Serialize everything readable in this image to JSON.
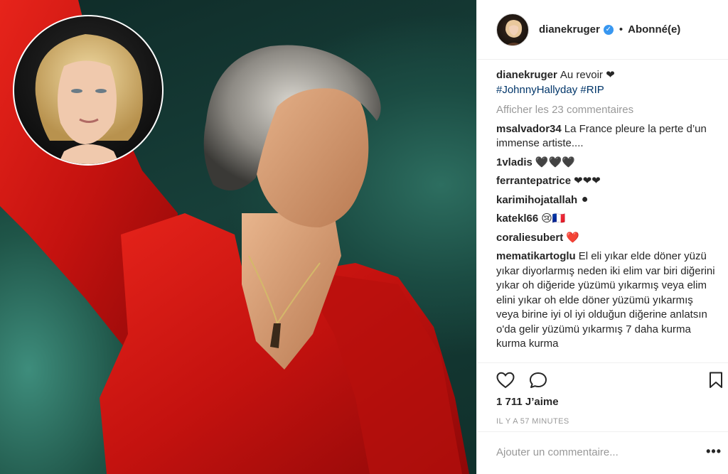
{
  "post": {
    "username": "dianekruger",
    "follow_status": "Abonné(e)",
    "separator": "•",
    "caption": {
      "username": "dianekruger",
      "text": "Au revoir ❤",
      "hashtags": "#JohnnyHallyday #RIP"
    },
    "view_comments_label": "Afficher les 23 commentaires",
    "comments": [
      {
        "username": "msalvador34",
        "text": "La France pleure la perte d’un immense artiste...."
      },
      {
        "username": "1vladis",
        "text": "🖤🖤🖤"
      },
      {
        "username": "ferrantepatrice",
        "text": "❤❤❤"
      },
      {
        "username": "karimihojatallah",
        "text": "⚫"
      },
      {
        "username": "katekl66",
        "text": "😢🇫🇷"
      },
      {
        "username": "coraliesubert",
        "text": "❤️"
      },
      {
        "username": "mematikartoglu",
        "text": "El eli yıkar elde döner yüzü yıkar diyorlarmış neden iki elim var biri diğerini yıkar oh diğeride yüzümü yıkarmış veya elim elini yıkar oh elde döner yüzümü yıkarmış veya birine iyi ol iyi olduğun diğerine anlatsın o'da gelir yüzümü yıkarmış 7 daha kurma kurma kurma"
      }
    ],
    "likes_label": "1 711 J’aime",
    "timestamp": "IL Y A 57 MINUTES",
    "add_comment_placeholder": "Ajouter un commentaire...",
    "options_label": "•••"
  },
  "icons": {
    "like": "heart-icon",
    "comment": "comment-icon",
    "save": "bookmark-icon",
    "verified": "verified-badge-icon",
    "options": "more-options-icon"
  },
  "colors": {
    "link": "#003569",
    "verified": "#3897f0",
    "muted": "#999999",
    "text": "#262626"
  }
}
